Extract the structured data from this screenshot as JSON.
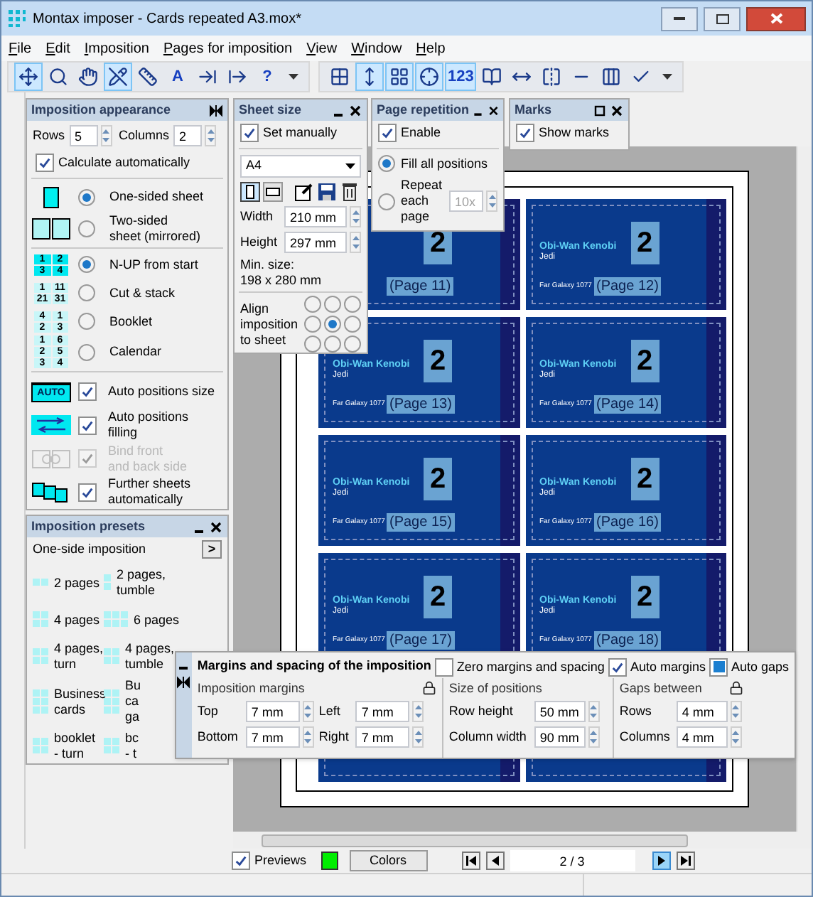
{
  "window": {
    "title": "Montax imposer - Cards repeated A3.mox*"
  },
  "menu": [
    {
      "label": "File"
    },
    {
      "label": "Edit"
    },
    {
      "label": "Imposition"
    },
    {
      "label": "Pages for imposition"
    },
    {
      "label": "View"
    },
    {
      "label": "Window"
    },
    {
      "label": "Help"
    }
  ],
  "toolbar_left": [
    {
      "kind": "move",
      "selected": true
    },
    {
      "kind": "zoom",
      "selected": false
    },
    {
      "kind": "hand",
      "selected": false
    },
    {
      "kind": "nocross",
      "selected": true
    },
    {
      "kind": "ruler",
      "selected": false
    },
    {
      "kind": "letter",
      "text": "A",
      "selected": false
    },
    {
      "kind": "import",
      "selected": false
    },
    {
      "kind": "export",
      "selected": false
    },
    {
      "kind": "letter",
      "text": "?",
      "selected": false
    },
    {
      "kind": "dropdown",
      "selected": false
    }
  ],
  "toolbar_right": [
    {
      "kind": "grid",
      "selected": false
    },
    {
      "kind": "fit",
      "selected": true
    },
    {
      "kind": "grid2",
      "selected": true
    },
    {
      "kind": "crosshair",
      "selected": true
    },
    {
      "kind": "letter",
      "text": "123",
      "selected": true
    },
    {
      "kind": "book",
      "selected": false
    },
    {
      "kind": "arrows",
      "selected": false
    },
    {
      "kind": "mirror",
      "selected": false
    },
    {
      "kind": "line",
      "selected": false
    },
    {
      "kind": "cols",
      "selected": false
    },
    {
      "kind": "check",
      "selected": false
    },
    {
      "kind": "dropdown",
      "selected": false
    }
  ],
  "appearance": {
    "title": "Imposition appearance",
    "rows_label": "Rows",
    "rows": "5",
    "columns_label": "Columns",
    "columns": "2",
    "calculate": {
      "label": "Calculate automatically",
      "checked": true
    },
    "sides": [
      {
        "kind": "one",
        "lines": [
          "One-sided sheet"
        ],
        "selected": true
      },
      {
        "kind": "two",
        "lines": [
          "Two-sided",
          "sheet (mirrored)"
        ],
        "selected": false
      }
    ],
    "orders": [
      {
        "label": "N-UP from start",
        "selected": true,
        "digits": [
          "1",
          "2",
          "3",
          "4"
        ]
      },
      {
        "label": "Cut & stack",
        "selected": false,
        "digits": [
          "1",
          "11",
          "21",
          "31"
        ]
      },
      {
        "label": "Booklet",
        "selected": false,
        "digits": [
          "4",
          "1",
          "2",
          "3"
        ]
      },
      {
        "label": "Calendar",
        "selected": false,
        "digits": [
          "1",
          "6",
          "2",
          "5",
          "3",
          "4"
        ]
      }
    ],
    "options": [
      {
        "kind": "auto-size",
        "badge": "AUTO",
        "lines": [
          "Auto positions size"
        ],
        "checked": true,
        "disabled": false
      },
      {
        "kind": "auto-fill",
        "lines": [
          "Auto positions",
          "filling"
        ],
        "checked": true,
        "disabled": false
      },
      {
        "kind": "bind",
        "lines": [
          "Bind front",
          "and back side"
        ],
        "checked": true,
        "disabled": true
      },
      {
        "kind": "further",
        "lines": [
          "Further sheets",
          "automatically"
        ],
        "checked": true,
        "disabled": false
      }
    ]
  },
  "presets": {
    "title": "Imposition presets",
    "group": "One-side imposition",
    "next": ">",
    "items": [
      {
        "kind": "pair",
        "lines": [
          "2 pages"
        ]
      },
      {
        "kind": "stack",
        "lines": [
          "2 pages,",
          "tumble"
        ]
      },
      {
        "kind": "quad",
        "lines": [
          "4 pages"
        ]
      },
      {
        "kind": "six",
        "lines": [
          "6 pages"
        ]
      },
      {
        "kind": "quad",
        "lines": [
          "4 pages,",
          "turn"
        ]
      },
      {
        "kind": "quad",
        "lines": [
          "4 pages,",
          "tumble"
        ]
      },
      {
        "kind": "cards",
        "lines": [
          "Business",
          "cards"
        ]
      },
      {
        "kind": "cards",
        "lines": [
          "Bu",
          "ca",
          "ga"
        ]
      },
      {
        "kind": "quad",
        "lines": [
          "booklet",
          "- turn"
        ]
      },
      {
        "kind": "quad",
        "lines": [
          "bc",
          "- t"
        ]
      }
    ]
  },
  "sheet_size": {
    "title": "Sheet size",
    "set_manually": {
      "label": "Set manually",
      "checked": true
    },
    "format": "A4",
    "orientation": [
      {
        "kind": "portrait",
        "selected": true
      },
      {
        "kind": "landscape",
        "selected": false
      }
    ],
    "width_label": "Width",
    "width": "210 mm",
    "height_label": "Height",
    "height": "297 mm",
    "min_label": "Min. size:",
    "min_value": "198 x 280 mm",
    "align_lines": [
      "Align",
      "imposition",
      "to sheet"
    ],
    "align": [
      {
        "selected": false
      },
      {
        "selected": false
      },
      {
        "selected": false
      },
      {
        "selected": false
      },
      {
        "selected": true
      },
      {
        "selected": false
      },
      {
        "selected": false
      },
      {
        "selected": false
      },
      {
        "selected": false
      }
    ]
  },
  "page_repetition": {
    "title": "Page repetition",
    "enable": {
      "label": "Enable",
      "checked": true
    },
    "modes": [
      {
        "lines": [
          "Fill all positions"
        ],
        "selected": true
      },
      {
        "lines": [
          "Repeat",
          "each",
          "page"
        ],
        "selected": false,
        "count": "10x"
      }
    ]
  },
  "marks": {
    "title": "Marks",
    "show_marks": {
      "label": "Show marks",
      "checked": true
    }
  },
  "margins": {
    "title": "Margins and spacing of the imposition",
    "toggles": [
      {
        "kind": "check",
        "label": "Zero margins and spacing",
        "checked": false
      },
      {
        "kind": "check",
        "label": "Auto margins",
        "checked": true
      },
      {
        "kind": "square",
        "label": "Auto gaps",
        "checked": true
      }
    ],
    "groups": [
      {
        "title": "Imposition margins",
        "lock": true,
        "fields": [
          {
            "label": "Top",
            "value": "7 mm"
          },
          {
            "label": "Left",
            "value": "7 mm"
          },
          {
            "label": "Bottom",
            "value": "7 mm"
          },
          {
            "label": "Right",
            "value": "7 mm"
          }
        ]
      },
      {
        "title": "Size of positions",
        "lock": false,
        "fields": [
          {
            "label": "Row height",
            "value": "50 mm"
          },
          {
            "label": "Column width",
            "value": "90 mm"
          }
        ]
      },
      {
        "title": "Gaps between",
        "lock": true,
        "fields": [
          {
            "label": "Rows",
            "value": "4 mm"
          },
          {
            "label": "Columns",
            "value": "4 mm"
          }
        ]
      }
    ]
  },
  "cards": [
    {
      "number": "2",
      "page": "(Page 11)"
    },
    {
      "name": "Obi-Wan Kenobi",
      "role": "Jedi",
      "number": "2",
      "page": "(Page 12)",
      "address": "Far Galaxy 1077"
    },
    {
      "name": "Obi-Wan Kenobi",
      "role": "Jedi",
      "number": "2",
      "page": "(Page 13)",
      "address": "Far Galaxy 1077"
    },
    {
      "name": "Obi-Wan Kenobi",
      "role": "Jedi",
      "number": "2",
      "page": "(Page 14)",
      "address": "Far Galaxy 1077"
    },
    {
      "name": "Obi-Wan Kenobi",
      "role": "Jedi",
      "number": "2",
      "page": "(Page 15)",
      "address": "Far Galaxy 1077"
    },
    {
      "name": "Obi-Wan Kenobi",
      "role": "Jedi",
      "number": "2",
      "page": "(Page 16)",
      "address": "Far Galaxy 1077"
    },
    {
      "name": "Obi-Wan Kenobi",
      "role": "Jedi",
      "number": "2",
      "page": "(Page 17)",
      "address": "Far Galaxy 1077"
    },
    {
      "name": "Obi-Wan Kenobi",
      "role": "Jedi",
      "number": "2",
      "page": "(Page 18)",
      "address": "Far Galaxy 1077"
    }
  ],
  "footer": {
    "previews": {
      "label": "Previews",
      "checked": true
    },
    "colors": "Colors",
    "page": "2 / 3"
  }
}
